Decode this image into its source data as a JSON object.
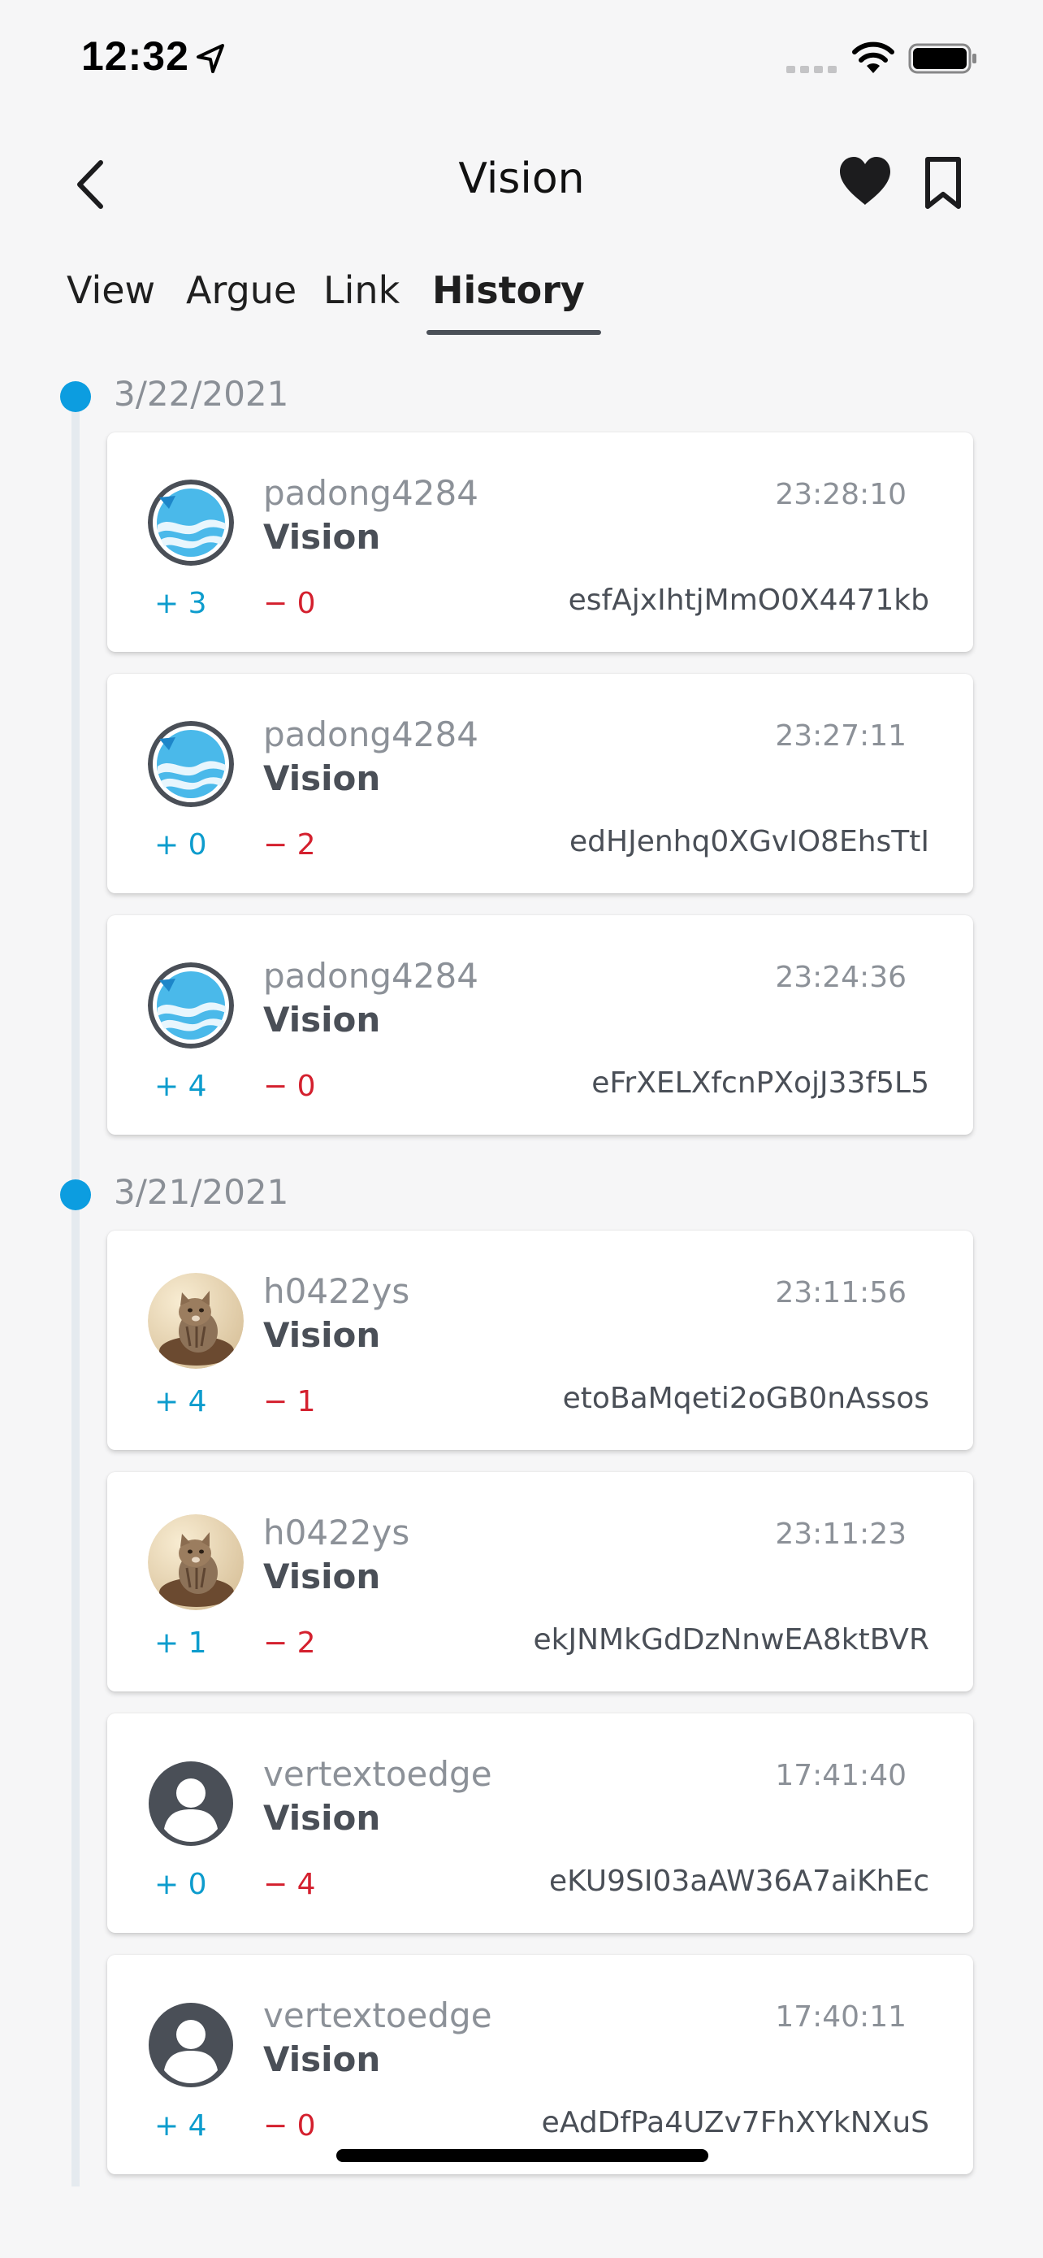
{
  "status_bar": {
    "time": "12:32"
  },
  "header": {
    "title": "Vision"
  },
  "tabs": [
    {
      "label": "View"
    },
    {
      "label": "Argue"
    },
    {
      "label": "Link"
    },
    {
      "label": "History",
      "active": true
    }
  ],
  "colors": {
    "accent": "#0c9de0",
    "plus": "#0d9ccd",
    "minus": "#d4202e",
    "text_muted": "#8c9198",
    "text_dark": "#4a4f57"
  },
  "history": [
    {
      "date": "3/22/2021",
      "entries": [
        {
          "avatar": "globe-avatar",
          "user": "padong4284",
          "title": "Vision",
          "time": "23:28:10",
          "plus": "+ 3",
          "minus": "− 0",
          "hash": "esfAjxIhtjMmO0X4471kb"
        },
        {
          "avatar": "globe-avatar",
          "user": "padong4284",
          "title": "Vision",
          "time": "23:27:11",
          "plus": "+ 0",
          "minus": "− 2",
          "hash": "edHJenhq0XGvIO8EhsTtI"
        },
        {
          "avatar": "globe-avatar",
          "user": "padong4284",
          "title": "Vision",
          "time": "23:24:36",
          "plus": "+ 4",
          "minus": "− 0",
          "hash": "eFrXELXfcnPXojJ33f5L5"
        }
      ]
    },
    {
      "date": "3/21/2021",
      "entries": [
        {
          "avatar": "cat-photo-avatar",
          "user": "h0422ys",
          "title": "Vision",
          "time": "23:11:56",
          "plus": "+ 4",
          "minus": "− 1",
          "hash": "etoBaMqeti2oGB0nAssos"
        },
        {
          "avatar": "cat-photo-avatar",
          "user": "h0422ys",
          "title": "Vision",
          "time": "23:11:23",
          "plus": "+ 1",
          "minus": "− 2",
          "hash": "ekJNMkGdDzNnwEA8ktBVR"
        },
        {
          "avatar": "person-avatar",
          "user": "vertextoedge",
          "title": "Vision",
          "time": "17:41:40",
          "plus": "+ 0",
          "minus": "− 4",
          "hash": "eKU9SI03aAW36A7aiKhEc"
        },
        {
          "avatar": "person-avatar",
          "user": "vertextoedge",
          "title": "Vision",
          "time": "17:40:11",
          "plus": "+ 4",
          "minus": "− 0",
          "hash": "eAdDfPa4UZv7FhXYkNXuS"
        }
      ]
    }
  ]
}
